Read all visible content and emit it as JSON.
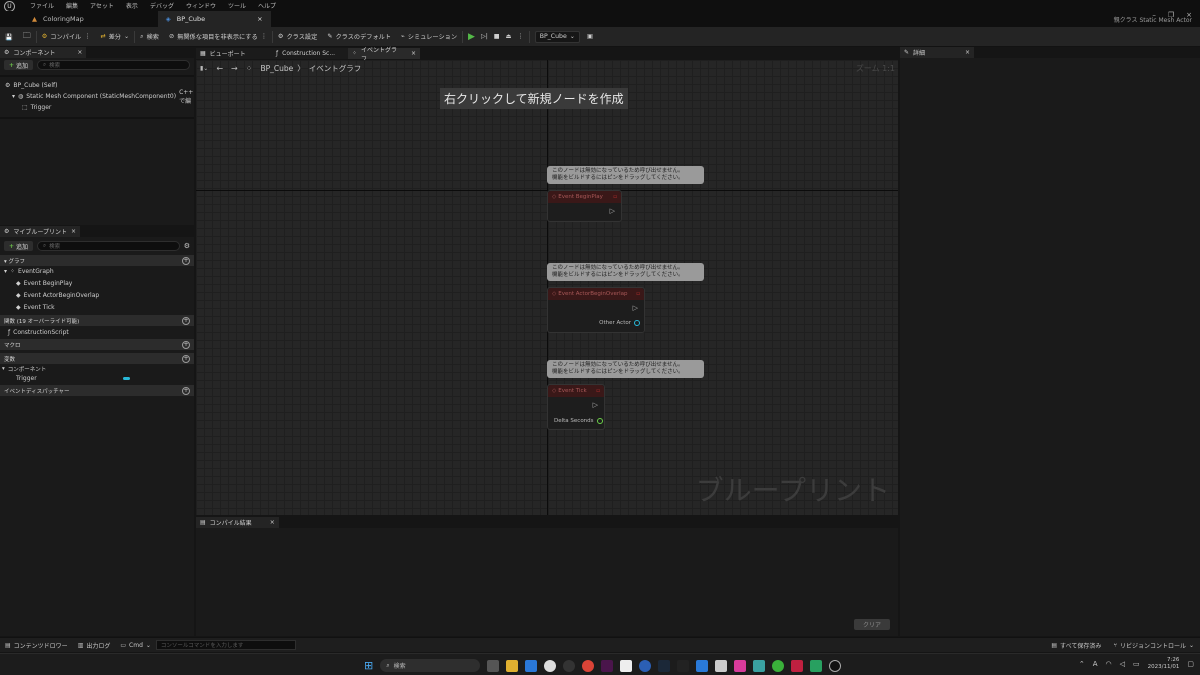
{
  "menubar": {
    "items": [
      "ファイル",
      "編集",
      "アセット",
      "表示",
      "デバッグ",
      "ウィンドウ",
      "ツール",
      "ヘルプ"
    ],
    "parent_class": "親クラス Static Mesh Actor"
  },
  "tabs": [
    {
      "label": "ColoringMap"
    },
    {
      "label": "BP_Cube"
    }
  ],
  "toolbar": {
    "compile": "コンパイル",
    "diff": "差分",
    "find": "検索",
    "hide_unrelated": "無関係な項目を非表示にする",
    "class_settings": "クラス設定",
    "class_defaults": "クラスのデフォルト",
    "simulation": "シミュレーション",
    "debug_target": "BP_Cube"
  },
  "components": {
    "tab": "コンポーネント",
    "add": "追加",
    "search_placeholder": "検索",
    "self": "BP_Cube (Self)",
    "mesh": "Static Mesh Component (StaticMeshComponent0)",
    "mesh_badge": "C++ で編",
    "trigger": "Trigger"
  },
  "mybp": {
    "tab": "マイブループリント",
    "add": "追加",
    "search_placeholder": "検索",
    "graph_section": "グラフ",
    "eventgraph": "EventGraph",
    "events": [
      "Event BeginPlay",
      "Event ActorBeginOverlap",
      "Event Tick"
    ],
    "functions_section": "関数 (19 オーバーライド可能)",
    "construction": "ConstructionScript",
    "macro_section": "マクロ",
    "vars_section": "変数",
    "comp_cat": "コンポーネント",
    "trigger_var": "Trigger",
    "dispatcher_section": "イベントディスパッチャー"
  },
  "graph_tabs": [
    "ビューポート",
    "Construction Sc...",
    "イベントグラフ"
  ],
  "graph": {
    "breadcrumb_bp": "BP_Cube",
    "breadcrumb_graph": "イベントグラフ",
    "zoom": "ズーム 1:1",
    "hint": "右クリックして新規ノードを作成",
    "watermark": "ブループリント",
    "comment_line1": "このノードは無効になっているため呼び出せません。",
    "comment_line2": "機能をビルドするにはピンをドラッグしてください。",
    "nodes": [
      {
        "title": "Event BeginPlay",
        "pin": ""
      },
      {
        "title": "Event ActorBeginOverlap",
        "pin": "Other Actor"
      },
      {
        "title": "Event Tick",
        "pin": "Delta Seconds"
      }
    ]
  },
  "details": {
    "tab": "詳細"
  },
  "compile_results": {
    "tab": "コンパイル結果",
    "clear": "クリア"
  },
  "statusbar": {
    "content_drawer": "コンテンツドロワー",
    "output_log": "出力ログ",
    "cmd": "Cmd",
    "console_placeholder": "コンソールコマンドを入力します",
    "save_all": "すべて保存済み",
    "revision": "リビジョンコントロール"
  },
  "taskbar": {
    "search": "検索",
    "time": "7:26",
    "date": "2023/11/01",
    "lang": "A"
  },
  "colors": {
    "accent": "#54b948",
    "node_header": "#3a1818",
    "pin_teal": "#28b8d8",
    "pin_green": "#6cd04a"
  }
}
